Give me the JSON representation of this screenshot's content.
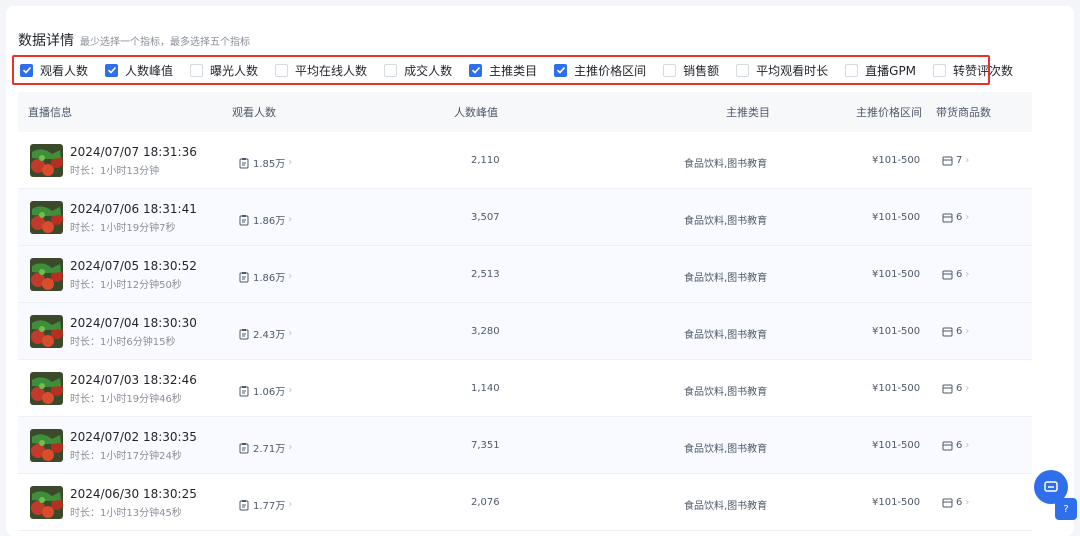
{
  "header": {
    "title": "数据详情",
    "hint": "最少选择一个指标，最多选择五个指标"
  },
  "filters": [
    {
      "label": "观看人数",
      "checked": true
    },
    {
      "label": "人数峰值",
      "checked": true
    },
    {
      "label": "曝光人数",
      "checked": false
    },
    {
      "label": "平均在线人数",
      "checked": false
    },
    {
      "label": "成交人数",
      "checked": false
    },
    {
      "label": "主推类目",
      "checked": true
    },
    {
      "label": "主推价格区间",
      "checked": true
    },
    {
      "label": "销售额",
      "checked": false
    },
    {
      "label": "平均观看时长",
      "checked": false
    },
    {
      "label": "直播GPM",
      "checked": false
    },
    {
      "label": "转赞评次数",
      "checked": false
    }
  ],
  "table": {
    "columns": [
      "直播信息",
      "观看人数",
      "人数峰值",
      "主推类目",
      "主推价格区间",
      "带货商品数"
    ],
    "rows": [
      {
        "datetime": "2024/07/07 18:31:36",
        "duration": "时长：1小时13分钟",
        "viewers": "1.85万",
        "peak": "2,110",
        "category": "食品饮料,图书教育",
        "price": "¥101-500",
        "goods": "7"
      },
      {
        "datetime": "2024/07/06 18:31:41",
        "duration": "时长：1小时19分钟7秒",
        "viewers": "1.86万",
        "peak": "3,507",
        "category": "食品饮料,图书教育",
        "price": "¥101-500",
        "goods": "6"
      },
      {
        "datetime": "2024/07/05 18:30:52",
        "duration": "时长：1小时12分钟50秒",
        "viewers": "1.86万",
        "peak": "2,513",
        "category": "食品饮料,图书教育",
        "price": "¥101-500",
        "goods": "6"
      },
      {
        "datetime": "2024/07/04 18:30:30",
        "duration": "时长：1小时6分钟15秒",
        "viewers": "2.43万",
        "peak": "3,280",
        "category": "食品饮料,图书教育",
        "price": "¥101-500",
        "goods": "6"
      },
      {
        "datetime": "2024/07/03 18:32:46",
        "duration": "时长：1小时19分钟46秒",
        "viewers": "1.06万",
        "peak": "1,140",
        "category": "食品饮料,图书教育",
        "price": "¥101-500",
        "goods": "6"
      },
      {
        "datetime": "2024/07/02 18:30:35",
        "duration": "时长：1小时17分钟24秒",
        "viewers": "2.71万",
        "peak": "7,351",
        "category": "食品饮料,图书教育",
        "price": "¥101-500",
        "goods": "6"
      },
      {
        "datetime": "2024/06/30 18:30:25",
        "duration": "时长：1小时13分钟45秒",
        "viewers": "1.77万",
        "peak": "2,076",
        "category": "食品饮料,图书教育",
        "price": "¥101-500",
        "goods": "6"
      }
    ]
  },
  "icons": {
    "chevron": "chevron-right-icon",
    "viewers": "clipboard-icon",
    "goods": "box-icon",
    "helper": "chat-icon"
  },
  "colors": {
    "accent": "#2f6fec",
    "highlight_border": "#e8322b"
  }
}
